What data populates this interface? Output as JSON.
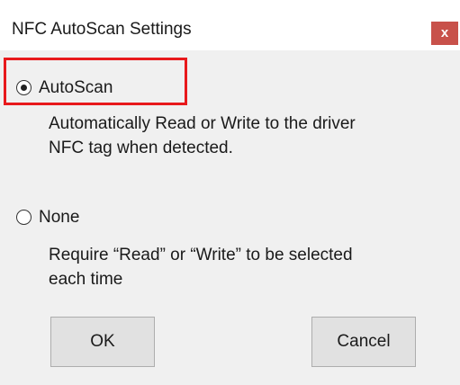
{
  "window": {
    "title": "NFC AutoScan Settings",
    "close_glyph": "x"
  },
  "options": {
    "autoscan": {
      "label": "AutoScan",
      "selected": true,
      "description_lines": [
        "Automatically Read or Write to the driver",
        "NFC tag when detected."
      ]
    },
    "none": {
      "label": "None",
      "selected": false,
      "description_lines": [
        "Require “Read” or “Write” to be selected",
        "each time"
      ]
    }
  },
  "buttons": {
    "ok_label": "OK",
    "cancel_label": "Cancel"
  },
  "colors": {
    "highlight_border": "#e8191c",
    "close_button": "#c8514a",
    "dialog_background": "#f0f0f0"
  },
  "icons": {
    "close": "close-icon",
    "radio_selected": "radio-checked-icon",
    "radio_unselected": "radio-unchecked-icon"
  }
}
